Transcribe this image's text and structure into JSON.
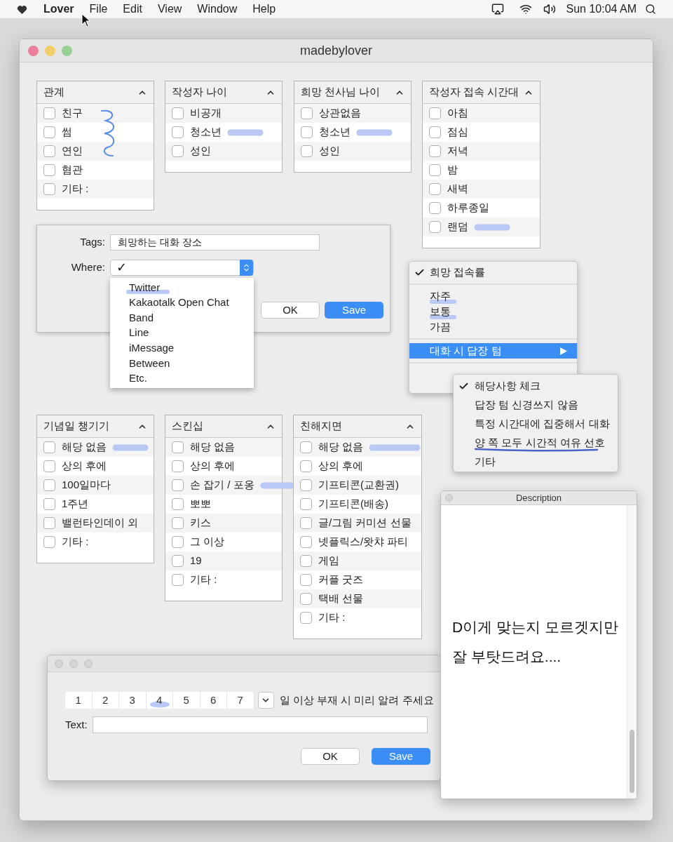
{
  "menu_bar": {
    "app_name": "Lover",
    "menus": [
      "File",
      "Edit",
      "View",
      "Window",
      "Help"
    ],
    "clock": "Sun 10:04 AM"
  },
  "window": {
    "title": "madebylover"
  },
  "checklists": [
    {
      "title": "관계",
      "scribble": true,
      "items": [
        {
          "label": "친구",
          "checked": false,
          "highlighted": false
        },
        {
          "label": "썸",
          "checked": false,
          "highlighted": false
        },
        {
          "label": "연인",
          "checked": false,
          "highlighted": false
        },
        {
          "label": "혐관",
          "checked": false,
          "highlighted": false
        },
        {
          "label": "기타 :",
          "checked": false,
          "highlighted": false
        }
      ]
    },
    {
      "title": "작성자 나이",
      "scribble": false,
      "items": [
        {
          "label": "비공개",
          "checked": false,
          "highlighted": false
        },
        {
          "label": "청소년",
          "checked": false,
          "highlighted": true
        },
        {
          "label": "성인",
          "checked": false,
          "highlighted": false
        }
      ]
    },
    {
      "title": "희망 천사님 나이",
      "scribble": false,
      "items": [
        {
          "label": "상관없음",
          "checked": false,
          "highlighted": false
        },
        {
          "label": "청소년",
          "checked": false,
          "highlighted": true
        },
        {
          "label": "성인",
          "checked": false,
          "highlighted": false
        }
      ]
    },
    {
      "title": "작성자 접속 시간대",
      "scribble": false,
      "items": [
        {
          "label": "아침",
          "checked": false,
          "highlighted": false
        },
        {
          "label": "점심",
          "checked": false,
          "highlighted": false
        },
        {
          "label": "저녁",
          "checked": false,
          "highlighted": false
        },
        {
          "label": "밤",
          "checked": false,
          "highlighted": false
        },
        {
          "label": "새벽",
          "checked": false,
          "highlighted": false
        },
        {
          "label": "하루종일",
          "checked": false,
          "highlighted": false
        },
        {
          "label": "랜덤",
          "checked": false,
          "highlighted": true
        }
      ]
    },
    {
      "title": "기념일 챙기기",
      "scribble": false,
      "items": [
        {
          "label": "해당 없음",
          "checked": false,
          "highlighted": true
        },
        {
          "label": "상의 후에",
          "checked": false,
          "highlighted": false
        },
        {
          "label": "100일마다",
          "checked": false,
          "highlighted": false
        },
        {
          "label": "1주년",
          "checked": false,
          "highlighted": false
        },
        {
          "label": "밸런타인데이 외",
          "checked": false,
          "highlighted": false
        },
        {
          "label": "기타 :",
          "checked": false,
          "highlighted": false
        }
      ]
    },
    {
      "title": "스킨십",
      "scribble": false,
      "items": [
        {
          "label": "해당 없음",
          "checked": false,
          "highlighted": false
        },
        {
          "label": "상의 후에",
          "checked": false,
          "highlighted": false
        },
        {
          "label": "손 잡기 / 포옹",
          "checked": false,
          "highlighted": true
        },
        {
          "label": "뽀뽀",
          "checked": false,
          "highlighted": false
        },
        {
          "label": "키스",
          "checked": false,
          "highlighted": false
        },
        {
          "label": "그 이상",
          "checked": false,
          "highlighted": false
        },
        {
          "label": "19",
          "checked": false,
          "highlighted": false
        },
        {
          "label": "기타 :",
          "checked": false,
          "highlighted": false
        }
      ]
    },
    {
      "title": "친해지면",
      "scribble": false,
      "items": [
        {
          "label": "해당 없음",
          "checked": false,
          "highlighted": true
        },
        {
          "label": "상의 후에",
          "checked": false,
          "highlighted": false
        },
        {
          "label": "기프티콘(교환권)",
          "checked": false,
          "highlighted": false
        },
        {
          "label": "기프티콘(배송)",
          "checked": false,
          "highlighted": false
        },
        {
          "label": "글/그림 커미션 선물",
          "checked": false,
          "highlighted": false
        },
        {
          "label": "넷플릭스/왓챠 파티",
          "checked": false,
          "highlighted": false
        },
        {
          "label": "게임",
          "checked": false,
          "highlighted": false
        },
        {
          "label": "커플 굿즈",
          "checked": false,
          "highlighted": false
        },
        {
          "label": "택배 선물",
          "checked": false,
          "highlighted": false
        },
        {
          "label": "기타 :",
          "checked": false,
          "highlighted": false
        }
      ]
    }
  ],
  "tags_sheet": {
    "tags_label": "Tags:",
    "tags_value": "희망하는 대화 장소",
    "where_label": "Where:",
    "where_value": "✓",
    "options": [
      {
        "label": "Twitter",
        "highlighted": true
      },
      {
        "label": "Kakaotalk Open Chat",
        "highlighted": false
      },
      {
        "label": "Band",
        "highlighted": false
      },
      {
        "label": "Line",
        "highlighted": false
      },
      {
        "label": "iMessage",
        "highlighted": false
      },
      {
        "label": "Between",
        "highlighted": false
      },
      {
        "label": "Etc.",
        "highlighted": false
      }
    ],
    "buttons": [
      {
        "label": "OK",
        "default": false
      },
      {
        "label": "Save",
        "default": true
      }
    ]
  },
  "menu": {
    "items": [
      {
        "kind": "item",
        "label": "희망 접속률",
        "checked": true,
        "highlighted": false,
        "selected": false,
        "submenu": false
      },
      {
        "kind": "separator"
      },
      {
        "kind": "item",
        "label": "자주",
        "checked": false,
        "highlighted": true,
        "selected": false,
        "submenu": false
      },
      {
        "kind": "item",
        "label": "보통",
        "checked": false,
        "highlighted": true,
        "selected": false,
        "submenu": false
      },
      {
        "kind": "item",
        "label": "가끔",
        "checked": false,
        "highlighted": false,
        "selected": false,
        "submenu": false
      },
      {
        "kind": "separator"
      },
      {
        "kind": "item",
        "label": "대화 시 답장 텀",
        "checked": false,
        "highlighted": false,
        "selected": true,
        "submenu": true
      },
      {
        "kind": "separator"
      }
    ],
    "submenu": [
      {
        "label": "해당사항 체크",
        "checked": true,
        "highlighted": false
      },
      {
        "label": "답장 텀 신경쓰지 않음",
        "checked": false,
        "highlighted": false
      },
      {
        "label": "특정 시간대에 집중해서 대화",
        "checked": false,
        "highlighted": false
      },
      {
        "label": "양 쪽 모두 시간적 여유 선호",
        "checked": false,
        "highlighted": true
      },
      {
        "label": "기타",
        "checked": false,
        "highlighted": false
      }
    ]
  },
  "absence_window": {
    "days": [
      {
        "label": "1",
        "highlighted": false
      },
      {
        "label": "2",
        "highlighted": false
      },
      {
        "label": "3",
        "highlighted": false
      },
      {
        "label": "4",
        "highlighted": true
      },
      {
        "label": "5",
        "highlighted": false
      },
      {
        "label": "6",
        "highlighted": false
      },
      {
        "label": "7",
        "highlighted": false
      }
    ],
    "suffix": "일 이상 부재 시 미리 알려 주세요",
    "text_label": "Text:",
    "buttons": [
      {
        "label": "OK",
        "default": false
      },
      {
        "label": "Save",
        "default": true
      }
    ]
  },
  "description_window": {
    "title": "Description",
    "text": "D이게 맞는지 모르겟지만\n잘 부탓드려요...."
  }
}
